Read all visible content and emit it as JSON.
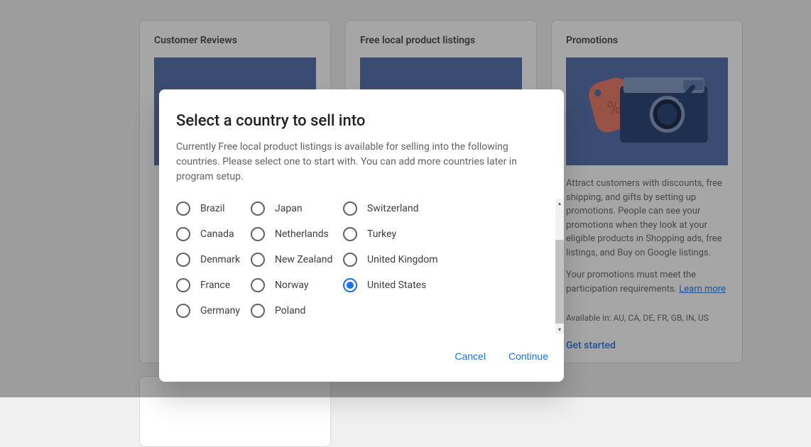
{
  "cards": {
    "reviews": {
      "title": "Customer Reviews"
    },
    "freeLocal": {
      "title": "Free local product listings"
    },
    "promotions": {
      "title": "Promotions",
      "body": "Attract customers with discounts, free shipping, and gifts by setting up promotions. People can see your promotions when they look at your eligible products in Shopping ads, free listings, and Buy on Google listings.",
      "requirement": "Your promotions must meet the participation requirements.",
      "learnMore": "Learn more",
      "availability": "Available in: AU, CA, DE, FR, GB, IN, US",
      "action": "Get started"
    }
  },
  "dialog": {
    "title": "Select a country to sell into",
    "subtitle": "Currently Free local product listings is available for selling into the following countries. Please select one to start with. You can add more countries later in program setup.",
    "countriesCol1": [
      "Brazil",
      "Canada",
      "Denmark",
      "France",
      "Germany"
    ],
    "countriesCol2": [
      "Japan",
      "Netherlands",
      "New Zealand",
      "Norway",
      "Poland"
    ],
    "countriesCol3": [
      "Switzerland",
      "Turkey",
      "United Kingdom",
      "United States"
    ],
    "selected": "United States",
    "cancel": "Cancel",
    "continue": "Continue"
  }
}
